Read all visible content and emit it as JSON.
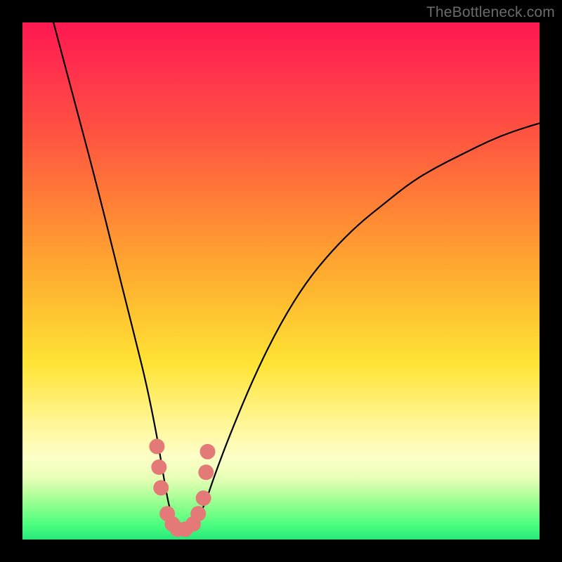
{
  "watermark": "TheBottleneck.com",
  "chart_data": {
    "type": "line",
    "title": "",
    "xlabel": "",
    "ylabel": "",
    "xlim": [
      0,
      100
    ],
    "ylim": [
      0,
      100
    ],
    "grid": false,
    "series": [
      {
        "name": "bottleneck-curve",
        "x": [
          6,
          10,
          14,
          18,
          20,
          22,
          24,
          26,
          27,
          28,
          29,
          30,
          31,
          33,
          35,
          37,
          40,
          45,
          50,
          55,
          60,
          65,
          70,
          75,
          80,
          85,
          90,
          95,
          100
        ],
        "y": [
          100,
          85,
          70,
          54,
          46,
          38,
          30,
          20,
          14,
          8,
          4,
          2,
          2,
          3,
          6,
          12,
          20,
          32,
          42,
          50,
          56,
          61,
          65,
          69,
          72,
          74.5,
          77,
          79,
          80.5
        ]
      }
    ],
    "markers": {
      "name": "highlight-dots",
      "color": "#e47a78",
      "points": [
        {
          "x": 26.0,
          "y": 18
        },
        {
          "x": 26.4,
          "y": 14
        },
        {
          "x": 26.8,
          "y": 10
        },
        {
          "x": 28.0,
          "y": 5
        },
        {
          "x": 29.0,
          "y": 3
        },
        {
          "x": 30.0,
          "y": 2
        },
        {
          "x": 31.5,
          "y": 2
        },
        {
          "x": 33.0,
          "y": 3
        },
        {
          "x": 34.0,
          "y": 5
        },
        {
          "x": 35.0,
          "y": 8
        },
        {
          "x": 35.5,
          "y": 13
        },
        {
          "x": 35.8,
          "y": 17
        }
      ]
    }
  }
}
